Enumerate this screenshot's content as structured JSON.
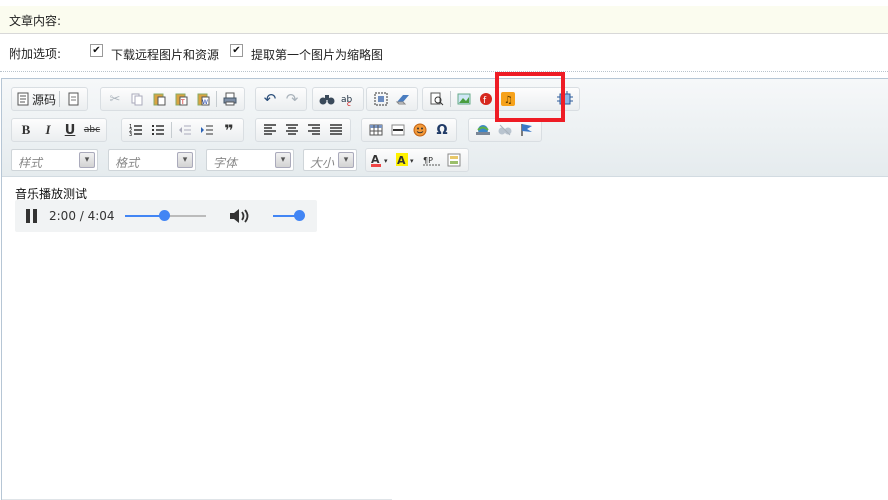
{
  "form": {
    "content_label": "文章内容:",
    "options_label": "附加选项:",
    "option1": {
      "label": "下载远程图片和资源",
      "checked": "✔"
    },
    "option2": {
      "label": "提取第一个图片为缩略图",
      "checked": "✔"
    }
  },
  "toolbar": {
    "source_label": "源码",
    "style_placeholder": "样式",
    "format_placeholder": "格式",
    "font_placeholder": "字体",
    "size_placeholder": "大小",
    "dropdown_glyph": "▾",
    "music_button_color": "#f6a21b"
  },
  "editor": {
    "music_title": "音乐播放测试",
    "player": {
      "time": "2:00 / 4:04",
      "progress": 0.49,
      "volume": 1.0
    }
  },
  "colors": {
    "highlight": "#ee1c25",
    "player_accent": "#4285f4"
  }
}
